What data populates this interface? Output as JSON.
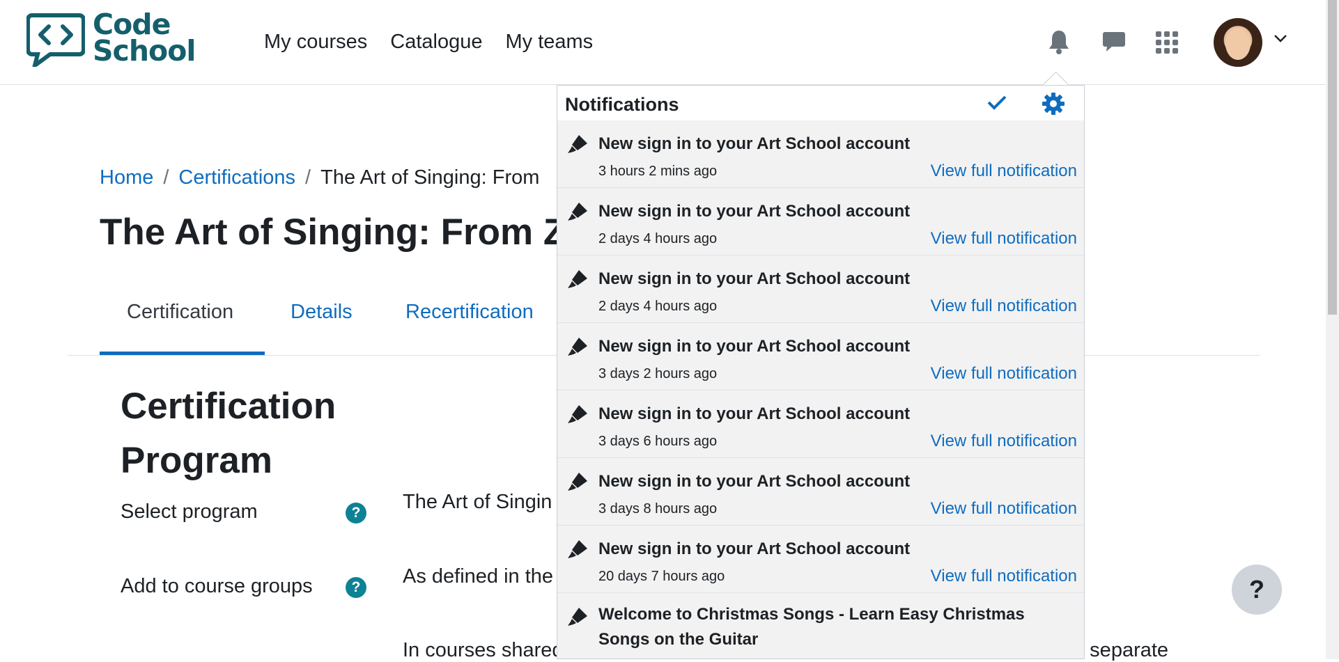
{
  "brand": {
    "line1": "Code",
    "line2": "School"
  },
  "nav": {
    "links": [
      "My courses",
      "Catalogue",
      "My teams"
    ]
  },
  "icons": {
    "bell": "bell-icon",
    "messages": "message-icon",
    "apps": "grid-icon",
    "avatar": "user-avatar",
    "chevron": "chevron-down-icon"
  },
  "breadcrumb": {
    "home": "Home",
    "sep": "/",
    "certifications": "Certifications",
    "current": "The Art of Singing: From"
  },
  "page": {
    "title": "The Art of Singing: From Z"
  },
  "tabs": [
    "Certification",
    "Details",
    "Recertification"
  ],
  "section": {
    "title": "Certification Program",
    "fields": [
      {
        "label": "Select program",
        "value": "The Art of Singin"
      },
      {
        "label": "Add to course groups",
        "value": "As defined in the"
      }
    ],
    "extra_text": "In courses shared",
    "trailing_text": "o separate"
  },
  "help_fab": "?",
  "help_icon": "?",
  "notifications": {
    "title": "Notifications",
    "view_label": "View full notification",
    "items": [
      {
        "title": "New sign in to your Art School account",
        "time": "3 hours 2 mins ago"
      },
      {
        "title": "New sign in to your Art School account",
        "time": "2 days 4 hours ago"
      },
      {
        "title": "New sign in to your Art School account",
        "time": "2 days 4 hours ago"
      },
      {
        "title": "New sign in to your Art School account",
        "time": "3 days 2 hours ago"
      },
      {
        "title": "New sign in to your Art School account",
        "time": "3 days 6 hours ago"
      },
      {
        "title": "New sign in to your Art School account",
        "time": "3 days 8 hours ago"
      },
      {
        "title": "New sign in to your Art School account",
        "time": "20 days 7 hours ago"
      },
      {
        "title": "Welcome to Christmas Songs - Learn Easy Christmas Songs on the Guitar",
        "time": ""
      }
    ]
  },
  "colors": {
    "brand": "#145f6b",
    "link": "#0f6cbf",
    "help": "#0d8295",
    "notif_bg": "#f2f2f2"
  }
}
